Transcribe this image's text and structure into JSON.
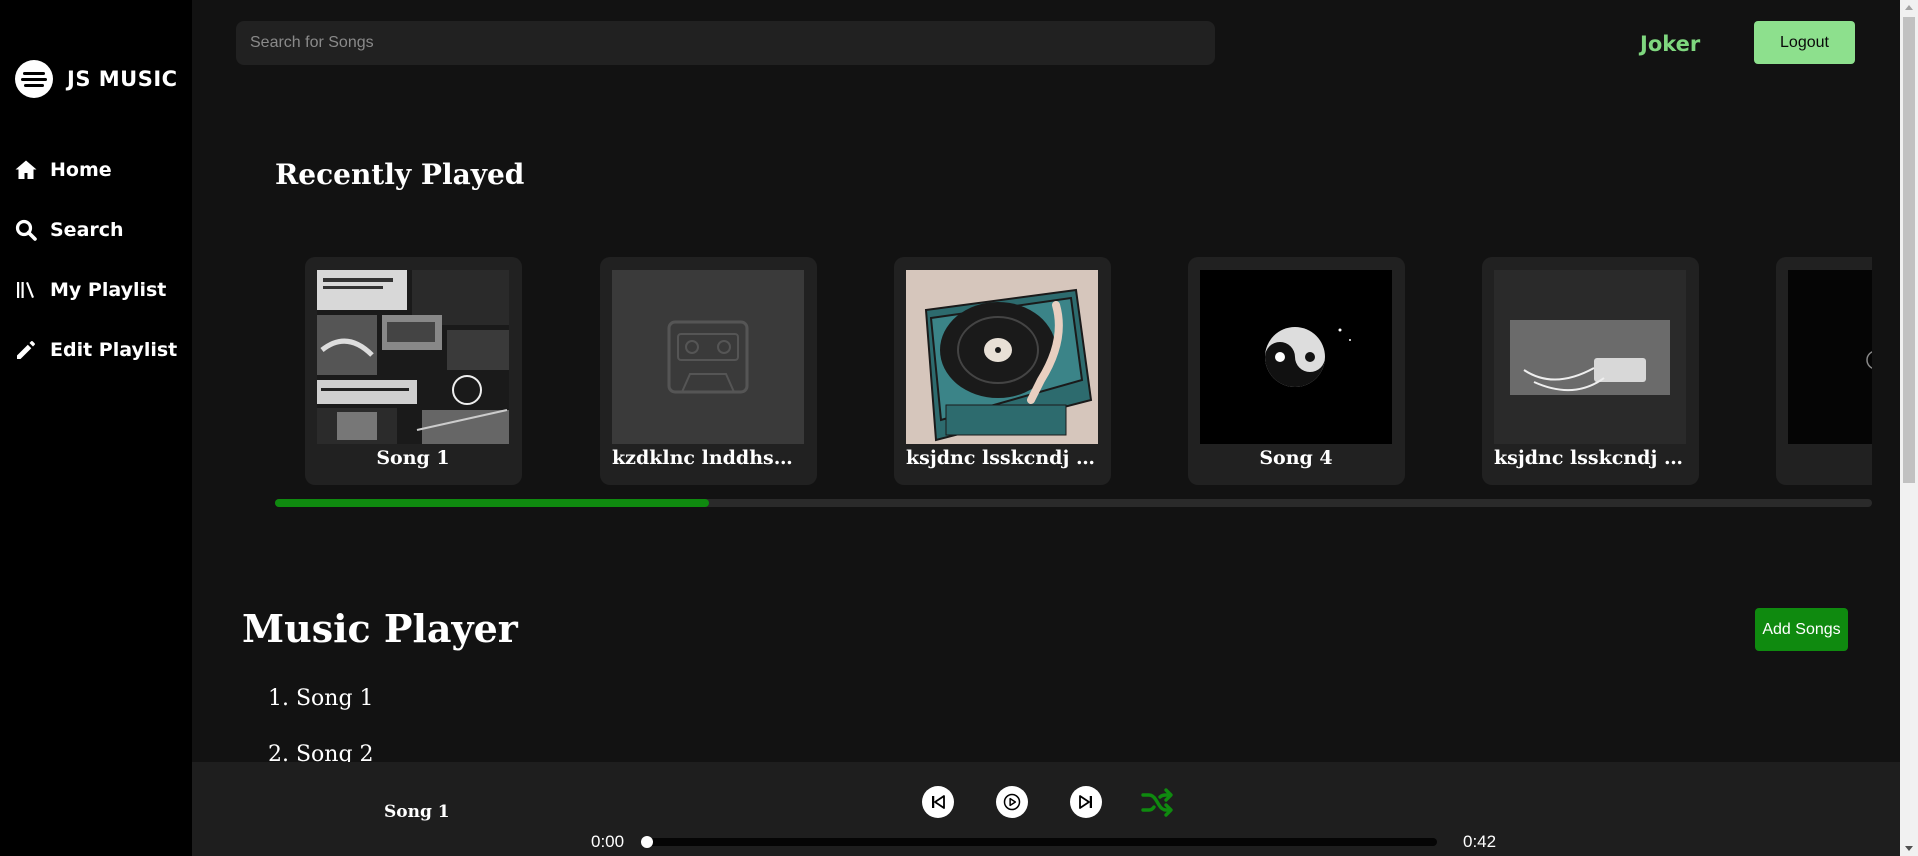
{
  "app": {
    "title": "JS MUSIC",
    "logo_icon": "music-logo-icon"
  },
  "sidebar": {
    "items": [
      {
        "label": "Home",
        "icon": "home-icon"
      },
      {
        "label": "Search",
        "icon": "search-icon"
      },
      {
        "label": "My Playlist",
        "icon": "library-icon"
      },
      {
        "label": "Edit Playlist",
        "icon": "pencil-icon"
      }
    ]
  },
  "header": {
    "search_placeholder": "Search for Songs",
    "user_name": "Joker",
    "logout_label": "Logout",
    "user_color": "#7fd77f",
    "logout_color": "#8de08d"
  },
  "recent": {
    "title": "Recently Played",
    "cards": [
      {
        "title": "Song 1"
      },
      {
        "title": "kzdklnc lnddhsd..."
      },
      {
        "title": "ksjdnc lsskcndj l..."
      },
      {
        "title": "Song 4"
      },
      {
        "title": "ksjdnc lsskcndj l..."
      },
      {
        "title": ""
      }
    ],
    "scroll_fraction": 0.272
  },
  "player_section": {
    "title": "Music Player",
    "add_label": "Add Songs",
    "accent": "#0f8a0f",
    "songs": [
      {
        "label": "1. Song 1"
      },
      {
        "label": "2. Song 2"
      }
    ]
  },
  "player_bar": {
    "now_playing": "Song 1",
    "current_time": "0:00",
    "duration": "0:42",
    "progress_fraction": 0.0,
    "shuffle_color": "#0f8a0f"
  }
}
